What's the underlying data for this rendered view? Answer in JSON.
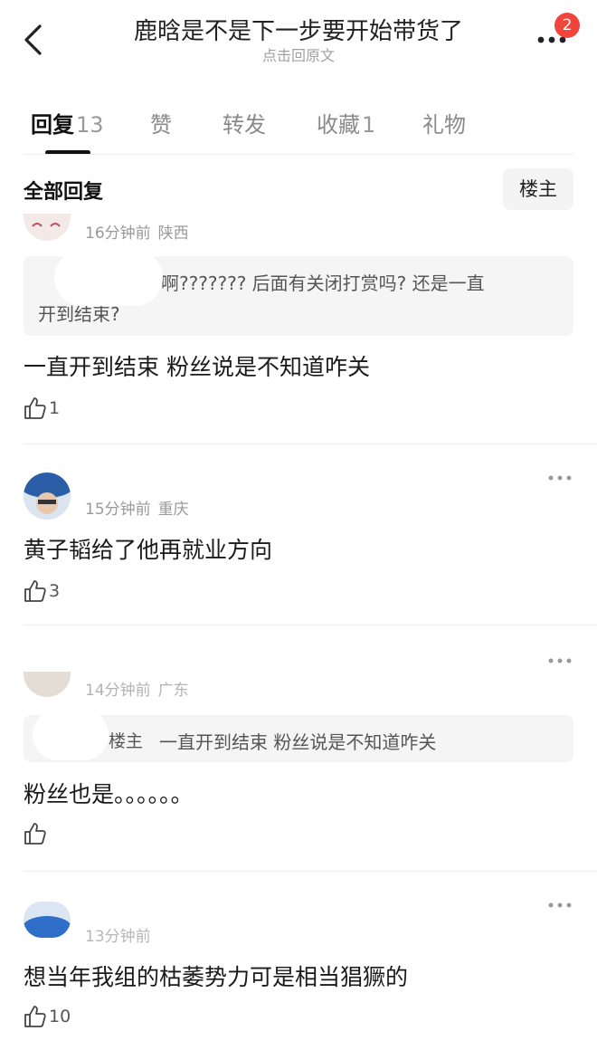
{
  "header": {
    "title": "鹿晗是不是下一步要开始带货了",
    "subtitle": "点击回原文",
    "badge_count": "2",
    "icons": [
      "chevron-left-icon",
      "more-dots-icon"
    ]
  },
  "tabs": [
    {
      "label": "回复",
      "count": "13",
      "active": true
    },
    {
      "label": "赞",
      "count": ""
    },
    {
      "label": "转发",
      "count": ""
    },
    {
      "label": "收藏",
      "count": "1"
    },
    {
      "label": "礼物",
      "count": ""
    }
  ],
  "section": {
    "title": "全部回复",
    "op_button": "楼主"
  },
  "comments": [
    {
      "time": "16分钟前",
      "location": "陕西",
      "quote_text": "啊??????? 后面有关闭打赏吗? 还是一直开到结束?",
      "quote_line1": "啊??????? 后面有关闭打赏吗? 还是一直",
      "quote_line2": "开到结束?",
      "text": "一直开到结束 粉丝说是不知道咋关",
      "likes": "1"
    },
    {
      "time": "15分钟前",
      "location": "重庆",
      "text": "黄子韬给了他再就业方向",
      "likes": "3"
    },
    {
      "time": "14分钟前",
      "location": "广东",
      "quote_tag": "楼主",
      "quote_text": "一直开到结束 粉丝说是不知道咋关",
      "text": "粉丝也是。。。。。。",
      "likes": ""
    },
    {
      "time": "13分钟前",
      "location": "",
      "text": "想当年我组的枯萎势力可是相当猖獗的",
      "likes": "10"
    }
  ],
  "colors": {
    "accent_badge": "#f0443c",
    "text_primary": "#1a1a1a",
    "text_secondary": "#9a9a9a",
    "quote_bg": "#f5f5f5"
  }
}
